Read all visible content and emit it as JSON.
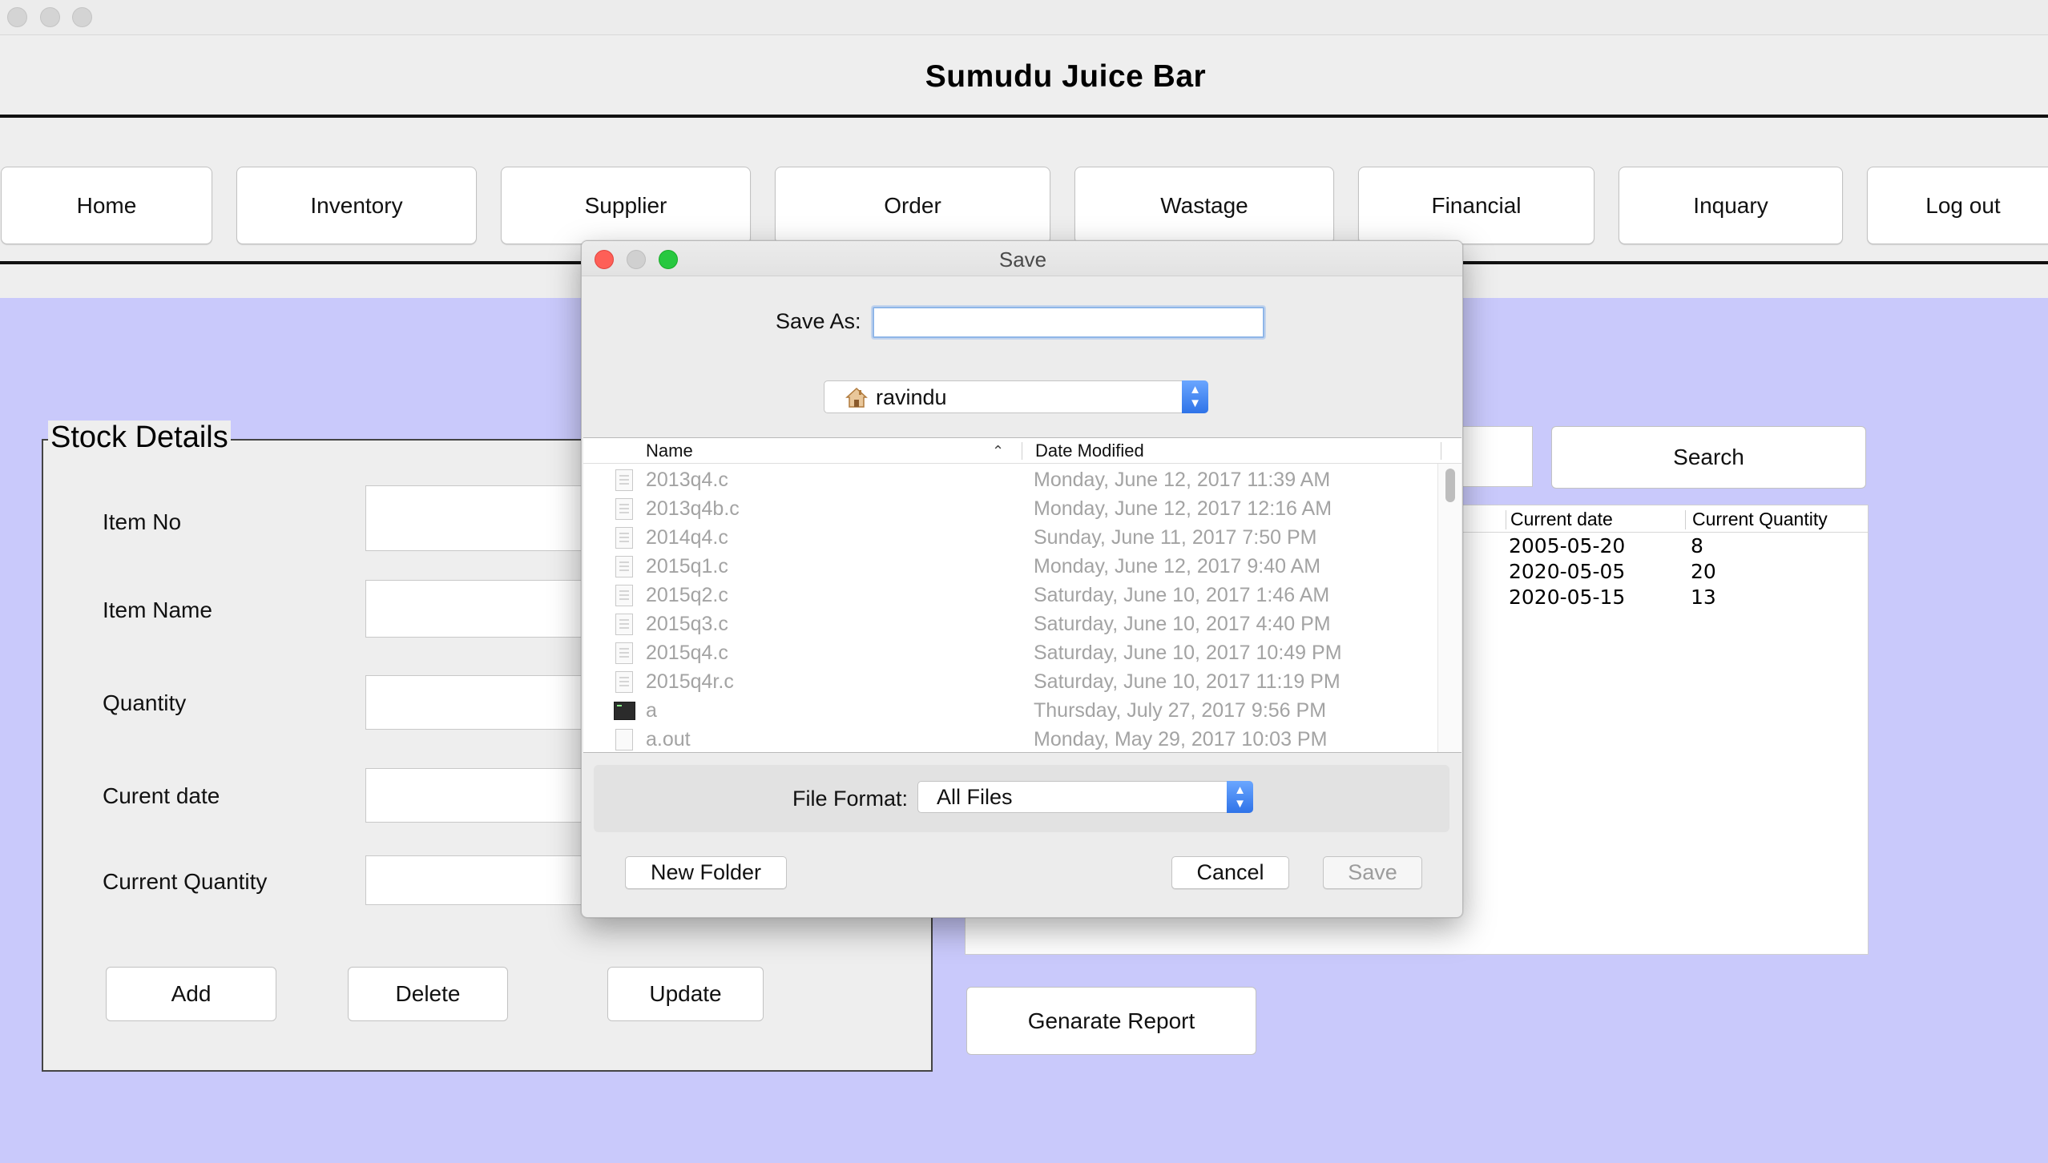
{
  "app": {
    "title": "Sumudu Juice Bar",
    "nav": [
      "Home",
      "Inventory",
      "Supplier",
      "Order",
      "Wastage",
      "Financial",
      "Inquary",
      "Log out"
    ]
  },
  "stock": {
    "legend": "Stock Details",
    "fields": [
      {
        "label": "Item No",
        "value": ""
      },
      {
        "label": "Item Name",
        "value": ""
      },
      {
        "label": "Quantity",
        "value": ""
      },
      {
        "label": "Curent date",
        "value": ""
      },
      {
        "label": "Current Quantity",
        "value": ""
      }
    ],
    "buttons": {
      "add": "Add",
      "delete": "Delete",
      "update": "Update"
    }
  },
  "right": {
    "search_label": "Search",
    "search_value": "",
    "table": {
      "headers": [
        "Current date",
        "Current Quantity"
      ],
      "rows": [
        [
          "2005-05-20",
          "8"
        ],
        [
          "2020-05-05",
          "20"
        ],
        [
          "2020-05-15",
          "13"
        ]
      ]
    },
    "report_label": "Genarate Report"
  },
  "dialog": {
    "title": "Save",
    "save_as_label": "Save As:",
    "save_as_value": "",
    "location": "ravindu",
    "columns": {
      "name": "Name",
      "date": "Date Modified"
    },
    "files": [
      {
        "name": "2013q4.c",
        "date": "Monday, June 12, 2017 11:39 AM",
        "icon": "document-icon"
      },
      {
        "name": "2013q4b.c",
        "date": "Monday, June 12, 2017 12:16 AM",
        "icon": "document-icon"
      },
      {
        "name": "2014q4.c",
        "date": "Sunday, June 11, 2017 7:50 PM",
        "icon": "document-icon"
      },
      {
        "name": "2015q1.c",
        "date": "Monday, June 12, 2017 9:40 AM",
        "icon": "document-icon"
      },
      {
        "name": "2015q2.c",
        "date": "Saturday, June 10, 2017 1:46 AM",
        "icon": "document-icon"
      },
      {
        "name": "2015q3.c",
        "date": "Saturday, June 10, 2017 4:40 PM",
        "icon": "document-icon"
      },
      {
        "name": "2015q4.c",
        "date": "Saturday, June 10, 2017 10:49 PM",
        "icon": "document-icon"
      },
      {
        "name": "2015q4r.c",
        "date": "Saturday, June 10, 2017 11:19 PM",
        "icon": "document-icon"
      },
      {
        "name": "a",
        "date": "Thursday, July 27, 2017 9:56 PM",
        "icon": "terminal-icon"
      },
      {
        "name": "a.out",
        "date": "Monday, May 29, 2017 10:03 PM",
        "icon": "blank-file-icon"
      }
    ],
    "file_format_label": "File Format:",
    "file_format_value": "All Files",
    "new_folder": "New Folder",
    "cancel": "Cancel",
    "save": "Save"
  },
  "colors": {
    "content_bg": "#c9c9fb",
    "window_bg": "#eeeeee",
    "accent_blue": "#2f73e8",
    "close_red": "#fe5f57",
    "minimize_yellow": "#d0d0d0",
    "zoom_green": "#28c840"
  }
}
